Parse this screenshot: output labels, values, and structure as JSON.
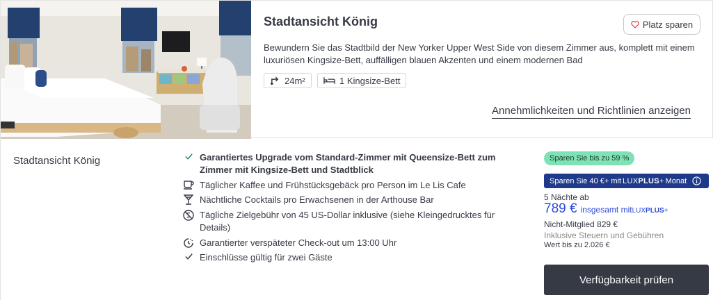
{
  "room": {
    "title": "Stadtansicht König",
    "save_label": "Platz sparen",
    "description": "Bewundern Sie das Stadtbild der New Yorker Upper West Side von diesem Zimmer aus, komplett mit einem luxuriösen Kingsize-Bett, auffälligen blauen Akzenten und einem modernen Bad",
    "size": "24m²",
    "bed": "1 Kingsize-Bett",
    "amenities_link": "Annehmlichkeiten und Richtlinien anzeigen"
  },
  "rate": {
    "name": "Stadtansicht König",
    "inclusions": [
      {
        "icon": "check-icon",
        "text": "Garantiertes Upgrade vom Standard-Zimmer mit Queensize-Bett zum Zimmer mit Kingsize-Bett und Stadtblick"
      },
      {
        "icon": "coffee-cup-icon",
        "text": "Täglicher Kaffee und Frühstücksgebäck pro Person im Le Lis Cafe"
      },
      {
        "icon": "cocktail-icon",
        "text": "Nächtliche Cocktails pro Erwachsenen in der Arthouse Bar"
      },
      {
        "icon": "no-fee-icon",
        "text": "Tägliche Zielgebühr von 45 US-Dollar inklusive (siehe Kleingedrucktes für Details)"
      },
      {
        "icon": "late-checkout-icon",
        "text": "Garantierter verspäteter Check-out um 13:00 Uhr"
      },
      {
        "icon": "check-icon",
        "text": "Einschlüsse gültig für zwei Gäste"
      }
    ]
  },
  "pricing": {
    "savings_badge": "Sparen Sie bis zu 59 %",
    "lux_banner_prefix": "Sparen Sie 40 €+ mit",
    "lux_brand_a": "LUX",
    "lux_brand_b": "PLUS",
    "lux_brand_plus": "+",
    "lux_banner_suffix": " Monat",
    "nights": "5 Nächte ab",
    "price": "789 €",
    "price_suffix_prefix": "insgesamt mit",
    "nonmember": "Nicht-Mitglied 829 €",
    "taxes": "Inklusive Steuern und Gebühren",
    "value": "Wert bis zu 2.026 €",
    "check_button": "Verfügbarkeit prüfen"
  },
  "colors": {
    "accent_blue": "#2e4bd8",
    "banner_navy": "#1f3a8a",
    "badge_green": "#7fe2b6",
    "button_dark": "#363a45"
  }
}
